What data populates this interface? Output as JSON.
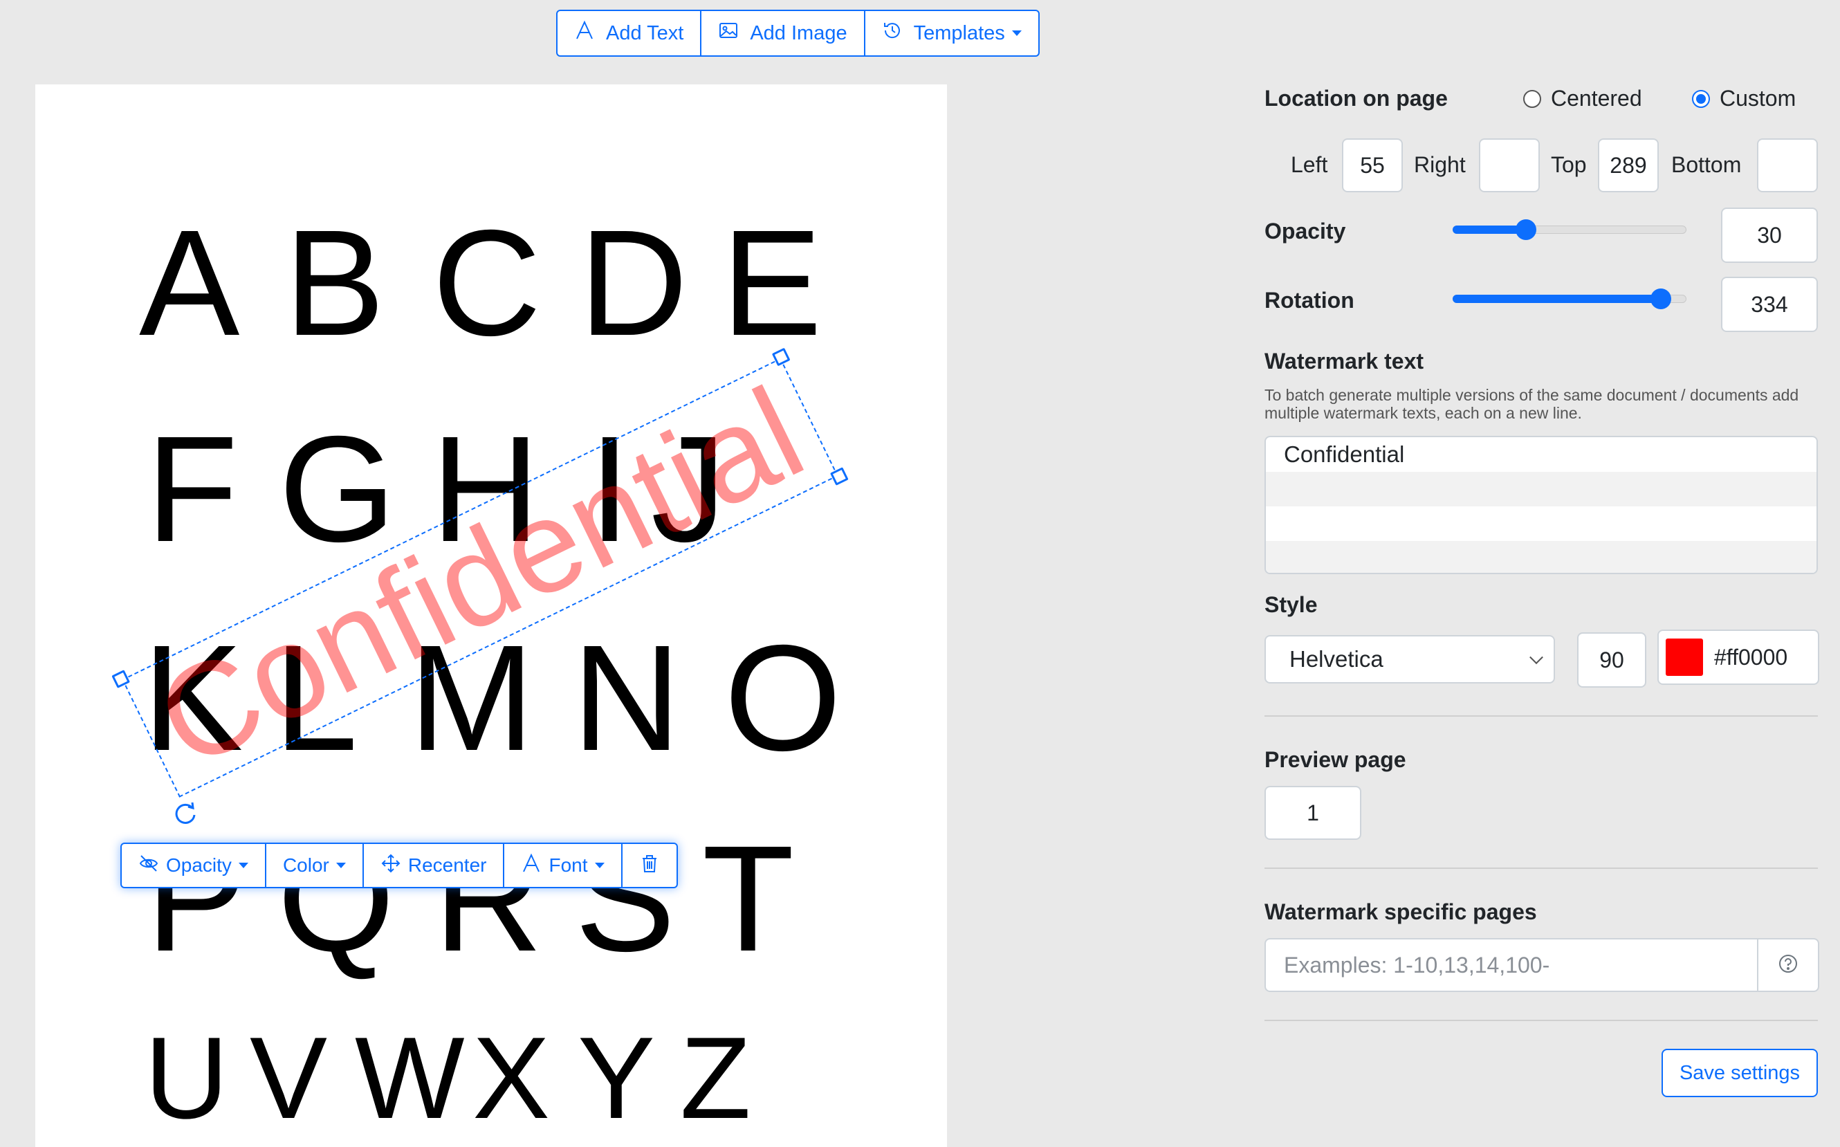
{
  "toolbar": {
    "add_text": "Add Text",
    "add_image": "Add Image",
    "templates": "Templates"
  },
  "page": {
    "rows": [
      [
        "A",
        "B",
        "C",
        "D",
        "E"
      ],
      [
        "F",
        "G",
        "H",
        "I",
        "J"
      ],
      [
        "K",
        "L",
        "M",
        "N",
        "O"
      ],
      [
        "P",
        "Q",
        "R",
        "S",
        "T"
      ],
      [
        "U",
        "V",
        "W",
        "X",
        "Y",
        "Z"
      ]
    ]
  },
  "watermark": {
    "text": "Confidential",
    "color": "#ff0000",
    "toolbar": {
      "opacity": "Opacity",
      "color": "Color",
      "recenter": "Recenter",
      "font": "Font"
    }
  },
  "settings": {
    "location_label": "Location on page",
    "centered_label": "Centered",
    "custom_label": "Custom",
    "selected_location": "Custom",
    "left_label": "Left",
    "left_value": "55",
    "right_label": "Right",
    "right_value": "",
    "top_label": "Top",
    "top_value": "289",
    "bottom_label": "Bottom",
    "bottom_value": "",
    "opacity_label": "Opacity",
    "opacity_value": "30",
    "opacity_slider_fraction": 0.3,
    "rotation_label": "Rotation",
    "rotation_value": "334",
    "rotation_slider_fraction": 0.93,
    "watermark_text_label": "Watermark text",
    "watermark_text_help": "To batch generate multiple versions of the same document / documents add multiple watermark texts, each on a new line.",
    "watermark_text_lines": [
      "Confidential",
      "",
      "",
      ""
    ],
    "style_label": "Style",
    "font_value": "Helvetica",
    "font_size_value": "90",
    "color_value": "#ff0000",
    "color_hex_label": "#ff0000",
    "preview_page_label": "Preview page",
    "preview_page_value": "1",
    "specific_pages_label": "Watermark specific pages",
    "specific_pages_placeholder": "Examples: 1-10,13,14,100-",
    "save_label": "Save settings"
  },
  "colors": {
    "accent": "#0d6efd",
    "background": "#e9e9e9"
  }
}
